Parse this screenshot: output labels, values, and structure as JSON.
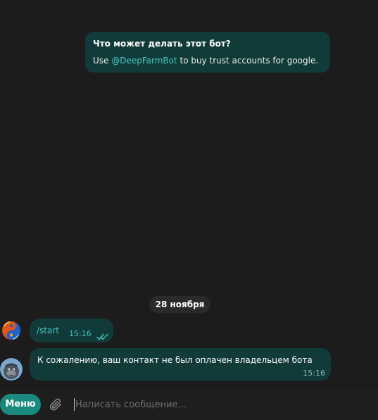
{
  "bot_info": {
    "title": "Что может делать этот бот?",
    "text_prefix": "Use ",
    "mention": "@DeepFarmBot",
    "text_suffix": " to buy trust accounts for google."
  },
  "date_separator": "28 ноября",
  "messages": [
    {
      "direction": "outgoing",
      "text": "/start",
      "time": "15:16",
      "status": "read",
      "avatar_icon": "yin-yang-fire-icon"
    },
    {
      "direction": "incoming",
      "text": "К сожалению, ваш контакт не был оплачен владельцем бота",
      "time": "15:16",
      "avatar_icon": "gorilla-avatar-icon"
    }
  ],
  "composer": {
    "menu_label": "Меню",
    "placeholder": "Написать сообщение...",
    "attach_icon": "paperclip-icon"
  },
  "colors": {
    "bubble": "#103b38",
    "accent": "#47c6c2",
    "menu_button": "#1a8a7f",
    "background": "#1c1c1c"
  }
}
